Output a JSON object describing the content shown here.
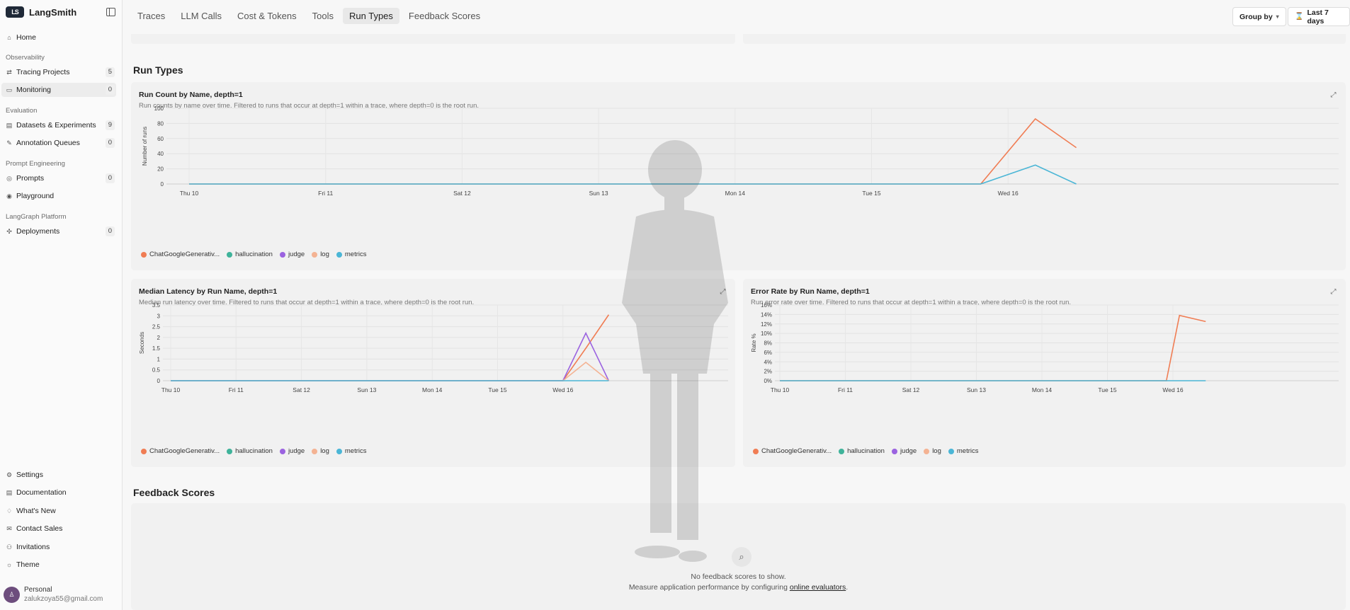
{
  "sidebar": {
    "brand": "LangSmith",
    "logo_text": "LS",
    "items": [
      {
        "label": "Home",
        "icon": "home-icon",
        "glyph": "⌂",
        "count": null
      },
      {
        "label": "Tracing Projects",
        "icon": "tracing-icon",
        "glyph": "⇄",
        "count": "5"
      },
      {
        "label": "Monitoring",
        "icon": "monitor-icon",
        "glyph": "▭",
        "count": "0"
      },
      {
        "label": "Datasets & Experiments",
        "icon": "database-icon",
        "glyph": "▤",
        "count": "9"
      },
      {
        "label": "Annotation Queues",
        "icon": "pen-icon",
        "glyph": "✎",
        "count": "0"
      },
      {
        "label": "Prompts",
        "icon": "prompt-icon",
        "glyph": "◎",
        "count": "0"
      },
      {
        "label": "Playground",
        "icon": "playground-icon",
        "glyph": "◉",
        "count": null
      },
      {
        "label": "Deployments",
        "icon": "deploy-icon",
        "glyph": "✣",
        "count": "0"
      }
    ],
    "sections": [
      "Observability",
      "Evaluation",
      "Prompt Engineering",
      "LangGraph Platform"
    ],
    "bottom_items": [
      {
        "label": "Settings",
        "icon": "gear-icon",
        "glyph": "⚙"
      },
      {
        "label": "Documentation",
        "icon": "doc-icon",
        "glyph": "▤"
      },
      {
        "label": "What's New",
        "icon": "bell-icon",
        "glyph": "♢"
      },
      {
        "label": "Contact Sales",
        "icon": "mail-icon",
        "glyph": "✉"
      },
      {
        "label": "Invitations",
        "icon": "invite-icon",
        "glyph": "⚇"
      },
      {
        "label": "Theme",
        "icon": "theme-icon",
        "glyph": "☼"
      }
    ],
    "user": {
      "label": "Personal",
      "email": "zalukzoya55@gmail.com"
    }
  },
  "tabs": [
    "Traces",
    "LLM Calls",
    "Cost & Tokens",
    "Tools",
    "Run Types",
    "Feedback Scores"
  ],
  "active_tab": "Run Types",
  "toolbar": {
    "group_by": "Group by",
    "range": "Last 7 days"
  },
  "run_types_title": "Run Types",
  "feedback_title": "Feedback Scores",
  "feedback_empty": {
    "line1": "No feedback scores to show.",
    "line2_prefix": "Measure application performance by configuring",
    "link": "online evaluators",
    "line2_suffix": "."
  },
  "colors": {
    "ChatGoogleGenerativ...": "#f07d54",
    "hallucination": "#3fb39a",
    "judge": "#9b63e0",
    "log": "#f4b393",
    "metrics": "#4bb6d6"
  },
  "chart_data": [
    {
      "type": "line",
      "title": "Run Count by Name, depth=1",
      "subtitle": "Run counts by name over time. Filtered to runs that occur at depth=1 within a trace, where depth=0 is the root run.",
      "ylabel": "Number of runs",
      "categories": [
        "Thu 10",
        "Fri 11",
        "Sat 12",
        "Sun 13",
        "Mon 14",
        "Tue 15",
        "Wed 16"
      ],
      "yticks": [
        "0",
        "20",
        "40",
        "60",
        "80",
        "100"
      ],
      "ylim": [
        0,
        100
      ],
      "x": [
        0,
        5.8,
        6.2,
        6.5
      ],
      "series": [
        {
          "name": "ChatGoogleGenerativ...",
          "values": [
            0,
            0,
            86,
            48
          ]
        },
        {
          "name": "metrics",
          "values": [
            0,
            0,
            25,
            0
          ]
        }
      ],
      "legend": [
        "ChatGoogleGenerativ...",
        "hallucination",
        "judge",
        "log",
        "metrics"
      ]
    },
    {
      "type": "line",
      "title": "Median Latency by Run Name, depth=1",
      "subtitle": "Median run latency over time. Filtered to runs that occur at depth=1 within a trace, where depth=0 is the root run.",
      "ylabel": "Seconds",
      "categories": [
        "Thu 10",
        "Fri 11",
        "Sat 12",
        "Sun 13",
        "Mon 14",
        "Tue 15",
        "Wed 16"
      ],
      "yticks": [
        "0",
        "0.5",
        "1",
        "1.5",
        "2",
        "2.5",
        "3",
        "3.5"
      ],
      "ylim": [
        0,
        3.5
      ],
      "x": [
        0,
        6.0,
        6.35,
        6.7
      ],
      "series": [
        {
          "name": "ChatGoogleGenerativ...",
          "values": [
            0,
            0,
            1.5,
            3.05
          ]
        },
        {
          "name": "judge",
          "values": [
            0,
            0,
            2.2,
            0
          ]
        },
        {
          "name": "log",
          "values": [
            0,
            0,
            0.85,
            0
          ]
        },
        {
          "name": "metrics",
          "values": [
            0,
            0,
            0,
            0
          ]
        }
      ],
      "legend": [
        "ChatGoogleGenerativ...",
        "hallucination",
        "judge",
        "log",
        "metrics"
      ]
    },
    {
      "type": "line",
      "title": "Error Rate by Run Name, depth=1",
      "subtitle": "Run error rate over time. Filtered to runs that occur at depth=1 within a trace, where depth=0 is the root run.",
      "ylabel": "Rate %",
      "categories": [
        "Thu 10",
        "Fri 11",
        "Sat 12",
        "Sun 13",
        "Mon 14",
        "Tue 15",
        "Wed 16"
      ],
      "yticks": [
        "0%",
        "2%",
        "4%",
        "6%",
        "8%",
        "10%",
        "12%",
        "14%",
        "16%"
      ],
      "ylim": [
        0,
        16
      ],
      "x": [
        0,
        5.9,
        6.1,
        6.5
      ],
      "series": [
        {
          "name": "ChatGoogleGenerativ...",
          "values": [
            0,
            0,
            13.8,
            12.5
          ]
        },
        {
          "name": "metrics",
          "values": [
            0,
            0,
            0,
            0
          ]
        }
      ],
      "legend": [
        "ChatGoogleGenerativ...",
        "hallucination",
        "judge",
        "log",
        "metrics"
      ]
    }
  ]
}
